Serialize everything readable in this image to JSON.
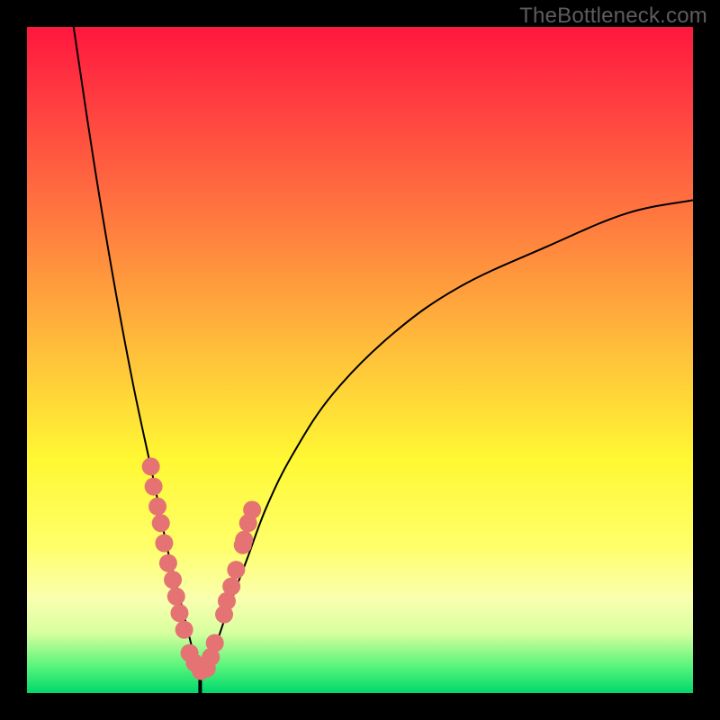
{
  "watermark": "TheBottleneck.com",
  "chart_data": {
    "type": "line",
    "title": "",
    "xlabel": "",
    "ylabel": "",
    "xlim": [
      0,
      100
    ],
    "ylim": [
      0,
      100
    ],
    "gradient_stops": [
      {
        "pct": 0,
        "color": "#ff173e"
      },
      {
        "pct": 12,
        "color": "#ff4041"
      },
      {
        "pct": 30,
        "color": "#ff7d3f"
      },
      {
        "pct": 50,
        "color": "#ffc43a"
      },
      {
        "pct": 65,
        "color": "#fff833"
      },
      {
        "pct": 78,
        "color": "#ffff6a"
      },
      {
        "pct": 86,
        "color": "#f9ffb0"
      },
      {
        "pct": 91,
        "color": "#d7ff9e"
      },
      {
        "pct": 96,
        "color": "#58f47b"
      },
      {
        "pct": 100,
        "color": "#00d86b"
      }
    ],
    "curve": {
      "description": "V-shaped bottleneck curve; minimum near x~26; left branch exits top edge near x~7; right branch reaches ~y=74 at x=100",
      "x": [
        7,
        10,
        13,
        16,
        19,
        21,
        23,
        25,
        26,
        27,
        28,
        30,
        33,
        36,
        40,
        46,
        55,
        65,
        78,
        90,
        100
      ],
      "y": [
        100,
        80,
        62,
        46,
        32,
        22,
        14,
        6,
        3,
        3,
        6,
        12,
        20,
        28,
        36,
        45,
        54,
        61,
        67,
        72,
        74
      ]
    },
    "sample_points": {
      "description": "benchmark sample markers clustered near the valley bottom on both branches",
      "x": [
        18.6,
        19.0,
        19.6,
        20.1,
        20.6,
        21.2,
        21.9,
        22.4,
        22.9,
        23.6,
        24.4,
        25.2,
        26.1,
        27.0,
        27.6,
        28.2,
        29.6,
        30.0,
        30.7,
        31.4,
        32.4,
        32.6,
        33.2,
        33.8
      ],
      "y": [
        34.0,
        31.0,
        28.0,
        25.5,
        22.5,
        19.5,
        17.0,
        14.5,
        12.0,
        9.5,
        6.0,
        4.5,
        3.3,
        3.7,
        5.4,
        7.5,
        11.8,
        13.8,
        16.0,
        18.5,
        22.2,
        23.0,
        25.5,
        27.5
      ]
    }
  }
}
